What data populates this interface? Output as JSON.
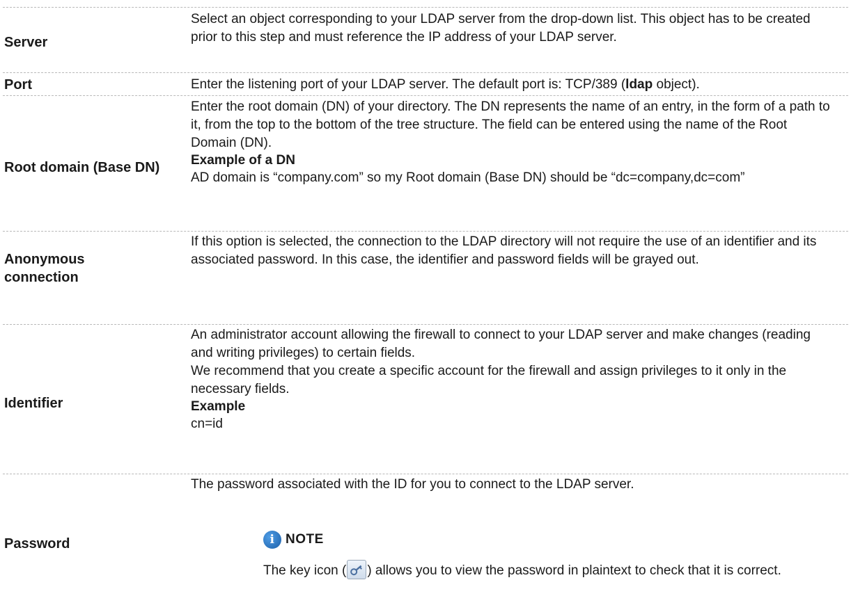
{
  "rows": {
    "server": {
      "label": "Server",
      "desc": "Select an object corresponding to your LDAP server from the drop-down list. This object has to be created prior to this step and must reference the IP address of your LDAP server."
    },
    "port": {
      "label": "Port",
      "desc_before": "Enter the listening port of your LDAP server. The default port is: TCP/389 (",
      "desc_bold": "ldap",
      "desc_after": " object)."
    },
    "root_domain": {
      "label": "Root domain (Base DN)",
      "desc": "Enter the root domain (DN) of your directory. The DN represents the name of an entry, in the form of a path to it, from the top to the bottom of the tree structure. The field can be entered using the name of the Root Domain (DN).",
      "example_title": "Example of a DN",
      "example_text": "AD domain is “company.com” so my Root domain (Base DN) should be “dc=company,dc=com”"
    },
    "anonymous": {
      "label": "Anonymous connection",
      "desc": "If this option is selected, the connection to the LDAP directory will not require the use of an identifier and its associated password. In this case, the identifier and password fields will be grayed out."
    },
    "identifier": {
      "label": "Identifier",
      "desc1": "An administrator account allowing the firewall to connect to your LDAP server and make changes (reading and writing privileges) to certain fields.",
      "desc2": "We recommend that you create a specific account for the firewall and assign privileges to it only in the necessary fields.",
      "example_title": "Example",
      "example_text": "cn=id"
    },
    "password": {
      "label": "Password",
      "desc": "The password associated with the ID for you to connect to the LDAP server.",
      "note_title": "NOTE",
      "note_before": "The key icon (",
      "note_after": ") allows you to view the password in plaintext to check that it is correct."
    }
  },
  "icons": {
    "note": "info-icon",
    "key": "key-icon"
  },
  "colors": {
    "info_blue": "#1c5fa8",
    "separator": "#b8b8b8"
  }
}
